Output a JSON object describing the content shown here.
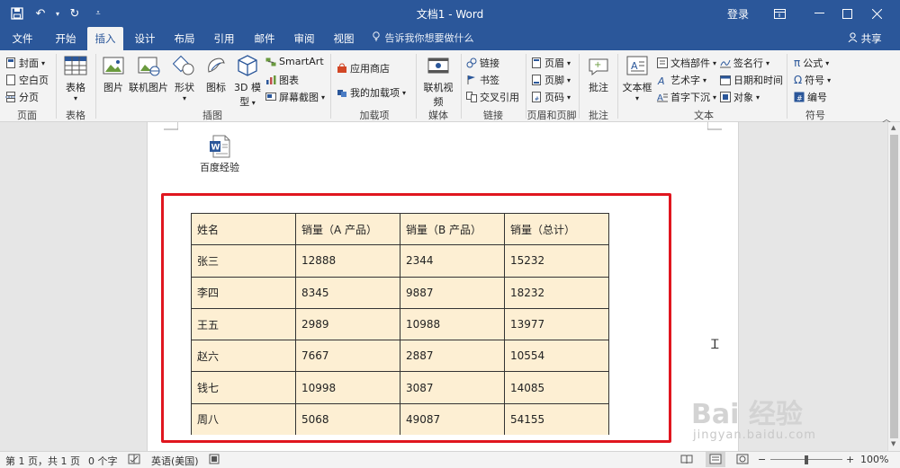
{
  "window": {
    "title": "文档1 - Word",
    "login_label": "登录"
  },
  "tabs": [
    "文件",
    "开始",
    "插入",
    "设计",
    "布局",
    "引用",
    "邮件",
    "审阅",
    "视图"
  ],
  "active_tab": "插入",
  "tellme_placeholder": "告诉我你想要做什么",
  "share_label": "共享",
  "ribbon": {
    "groups": {
      "pages": "页面",
      "tables": "表格",
      "illustrations": "插图",
      "addins": "加载项",
      "media": "媒体",
      "links": "链接",
      "header_footer": "页眉和页脚",
      "comments": "批注",
      "text": "文本",
      "symbols": "符号"
    },
    "pages_items": [
      "封面",
      "空白页",
      "分页"
    ],
    "table_label": "表格",
    "illustration_items": {
      "picture": "图片",
      "online_picture": "联机图片",
      "shapes": "形状",
      "icons": "图标",
      "model_3d_line1": "3D 模",
      "model_3d_line2": "型",
      "smartart": "SmartArt",
      "chart": "图表",
      "screenshot": "屏幕截图"
    },
    "addin_items": [
      "应用商店",
      "我的加载项"
    ],
    "media_item": "联机视频",
    "link_items": [
      "链接",
      "书签",
      "交叉引用"
    ],
    "header_footer_items": [
      "页眉",
      "页脚",
      "页码"
    ],
    "comment_item": "批注",
    "text_items": {
      "textbox": "文本框",
      "quick_parts": "文档部件",
      "wordart": "艺术字",
      "dropcap": "首字下沉",
      "signature": "签名行",
      "datetime": "日期和时间",
      "object": "对象"
    },
    "symbol_items": [
      "公式",
      "符号",
      "编号"
    ]
  },
  "document": {
    "embedded_object_label": "百度经验",
    "table": {
      "headers": [
        "姓名",
        "销量（A 产品）",
        "销量（B 产品）",
        "销量（总计）"
      ],
      "rows": [
        [
          "张三",
          "12888",
          "2344",
          "15232"
        ],
        [
          "李四",
          "8345",
          "9887",
          "18232"
        ],
        [
          "王五",
          "2989",
          "10988",
          "13977"
        ],
        [
          "赵六",
          "7667",
          "2887",
          "10554"
        ],
        [
          "钱七",
          "10998",
          "3087",
          "14085"
        ],
        [
          "周八",
          "5068",
          "49087",
          "54155"
        ]
      ]
    },
    "highlight_color": "#e0161f",
    "cell_fill_color": "#fdefd3"
  },
  "status": {
    "page": "第 1 页，共 1 页",
    "words": "0 个字",
    "language": "英语(美国)",
    "zoom": "100%"
  },
  "watermark": {
    "main": "Bai 经验",
    "sub": "jingyan.baidu.com"
  },
  "colors": {
    "brand": "#2b579a"
  }
}
